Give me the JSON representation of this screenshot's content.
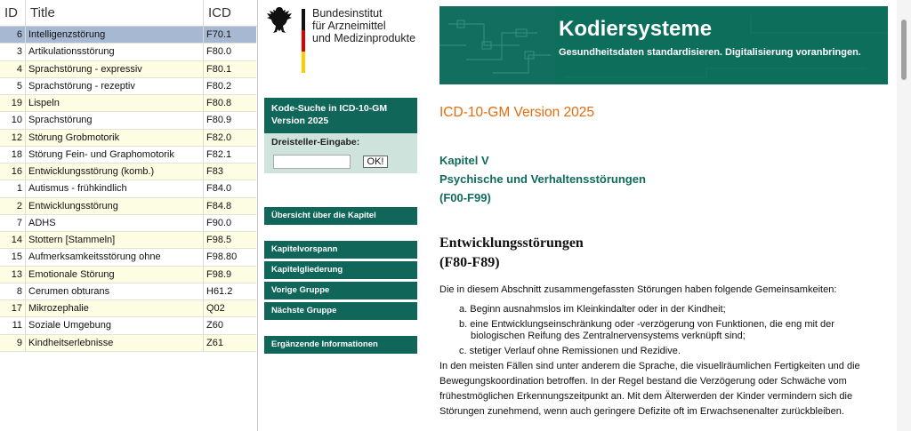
{
  "table": {
    "headers": {
      "id": "ID",
      "title": "Title",
      "icd": "ICD"
    },
    "rows": [
      {
        "id": "6",
        "title": "Intelligenzstörung",
        "icd": "F70.1"
      },
      {
        "id": "3",
        "title": "Artikulationsstörung",
        "icd": "F80.0"
      },
      {
        "id": "4",
        "title": "Sprachstörung - expressiv",
        "icd": "F80.1"
      },
      {
        "id": "5",
        "title": "Sprachstörung - rezeptiv",
        "icd": "F80.2"
      },
      {
        "id": "19",
        "title": "Lispeln",
        "icd": "F80.8"
      },
      {
        "id": "10",
        "title": "Sprachstörung",
        "icd": "F80.9"
      },
      {
        "id": "12",
        "title": "Störung Grobmotorik",
        "icd": "F82.0"
      },
      {
        "id": "18",
        "title": "Störung Fein- und Graphomotorik",
        "icd": "F82.1"
      },
      {
        "id": "16",
        "title": "Entwicklungsstörung (komb.)",
        "icd": "F83"
      },
      {
        "id": "1",
        "title": "Autismus - frühkindlich",
        "icd": "F84.0"
      },
      {
        "id": "2",
        "title": "Entwicklungsstörung",
        "icd": "F84.8"
      },
      {
        "id": "7",
        "title": "ADHS",
        "icd": "F90.0"
      },
      {
        "id": "14",
        "title": "Stottern [Stammeln]",
        "icd": "F98.5"
      },
      {
        "id": "15",
        "title": "Aufmerksamkeitsstörung ohne",
        "icd": "F98.80"
      },
      {
        "id": "13",
        "title": "Emotionale Störung",
        "icd": "F98.9"
      },
      {
        "id": "8",
        "title": "Cerumen obturans",
        "icd": "H61.2"
      },
      {
        "id": "17",
        "title": "Mikrozephalie",
        "icd": "Q02"
      },
      {
        "id": "11",
        "title": "Soziale Umgebung",
        "icd": "Z60"
      },
      {
        "id": "9",
        "title": "Kindheitserlebnisse",
        "icd": "Z61"
      }
    ]
  },
  "logo": {
    "line1": "Bundesinstitut",
    "line2": "für Arzneimittel",
    "line3": "und Medizinprodukte"
  },
  "banner": {
    "title": "Kodiersysteme",
    "subtitle": "Gesundheitsdaten standardisieren. Digitalisierung voranbringen."
  },
  "nav": {
    "search_title_line1": "Kode-Suche in ICD-10-GM",
    "search_title_line2": "Version 2025",
    "search_label": "Dreisteller-Eingabe:",
    "search_value": "",
    "search_button": "OK!",
    "overview": "Übersicht über die Kapitel",
    "chapter_preface": "Kapitelvorspann",
    "chapter_structure": "Kapitelgliederung",
    "previous_group": "Vorige Gruppe",
    "next_group": "Nächste Gruppe",
    "additional_info": "Ergänzende Informationen"
  },
  "content": {
    "version": "ICD-10-GM Version 2025",
    "chapter_line1": "Kapitel V",
    "chapter_line2": "Psychische und Verhaltensstörungen",
    "chapter_line3": "(F00-F99)",
    "group_title_line1": "Entwicklungsstörungen",
    "group_title_line2": "(F80-F89)",
    "intro": "Die in diesem Abschnitt zusammengefassten Störungen haben folgende Gemeinsamkeiten:",
    "items": [
      {
        "marker": "a.",
        "line1": "Beginn ausnahmslos im Kleinkindalter oder in der Kindheit;",
        "line2": ""
      },
      {
        "marker": "b.",
        "line1": "eine Entwicklungseinschränkung oder -verzögerung von Funktionen, die eng mit der",
        "line2": "biologischen Reifung des Zentralnervensystems verknüpft sind;"
      },
      {
        "marker": "c.",
        "line1": "stetiger Verlauf ohne Remissionen und Rezidive.",
        "line2": ""
      }
    ],
    "body_lines": [
      "In den meisten Fällen sind unter anderem die Sprache, die visuellräumlichen Fertigkeiten und die",
      "Bewegungskoordination betroffen. In der Regel bestand die Verzögerung oder Schwäche vom",
      "frühestmöglichen Erkennungszeitpunkt an. Mit dem Älterwerden der Kinder vermindern sich die",
      "Störungen zunehmend, wenn auch geringere Defizite oft im Erwachsenenalter zurückbleiben."
    ]
  },
  "colors": {
    "accent_green": "#11665a",
    "version_orange": "#e46c0a",
    "row_selected": "#a7b9d2",
    "row_alt": "#fdfde3"
  }
}
